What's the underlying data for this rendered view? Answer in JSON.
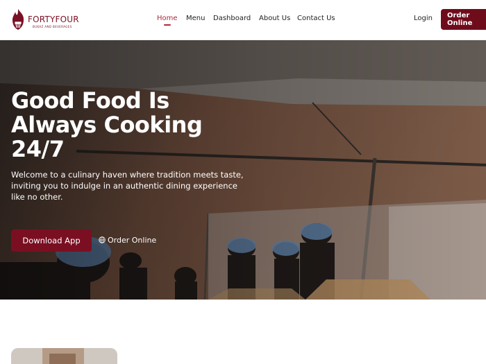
{
  "brand": {
    "name": "FORTYFOUR",
    "tagline": "BUKAZ AND BEVERAGES",
    "accent": "#6f0c1c"
  },
  "nav": {
    "items": [
      {
        "label": "Home",
        "active": true
      },
      {
        "label": "Menu",
        "active": false
      },
      {
        "label": "Dashboard",
        "active": false
      },
      {
        "label": "About Us",
        "active": false
      },
      {
        "label": "Contact Us",
        "active": false
      }
    ],
    "login_label": "Login",
    "order_label": "Order Online"
  },
  "hero": {
    "title": "Good Food Is Always Cooking 24/7",
    "text": "Welcome to a culinary haven where tradition meets taste, inviting you to indulge in an authentic dining experience like no other.",
    "download_label": "Download App",
    "order_label": "Order Online",
    "order_icon": "globe-icon"
  }
}
